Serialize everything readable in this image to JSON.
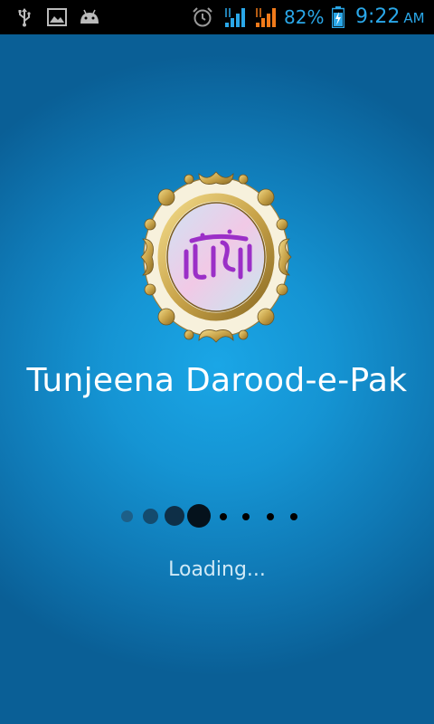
{
  "status_bar": {
    "battery_percent": "82%",
    "time": "9:22",
    "ampm": "AM",
    "icons": [
      "usb-icon",
      "image-icon",
      "android-icon",
      "alarm-icon",
      "signal-icon",
      "signal-icon-2",
      "battery-charging-icon"
    ]
  },
  "app": {
    "title": "Tunjeena Darood-e-Pak",
    "loading_text": "Loading...",
    "logo_icon": "ornate-frame-logo-icon"
  },
  "colors": {
    "accent": "#2aa7e8",
    "background": "#1594d3",
    "frame_gold": "#c9a44a",
    "logo_text": "#9b2fc7"
  }
}
